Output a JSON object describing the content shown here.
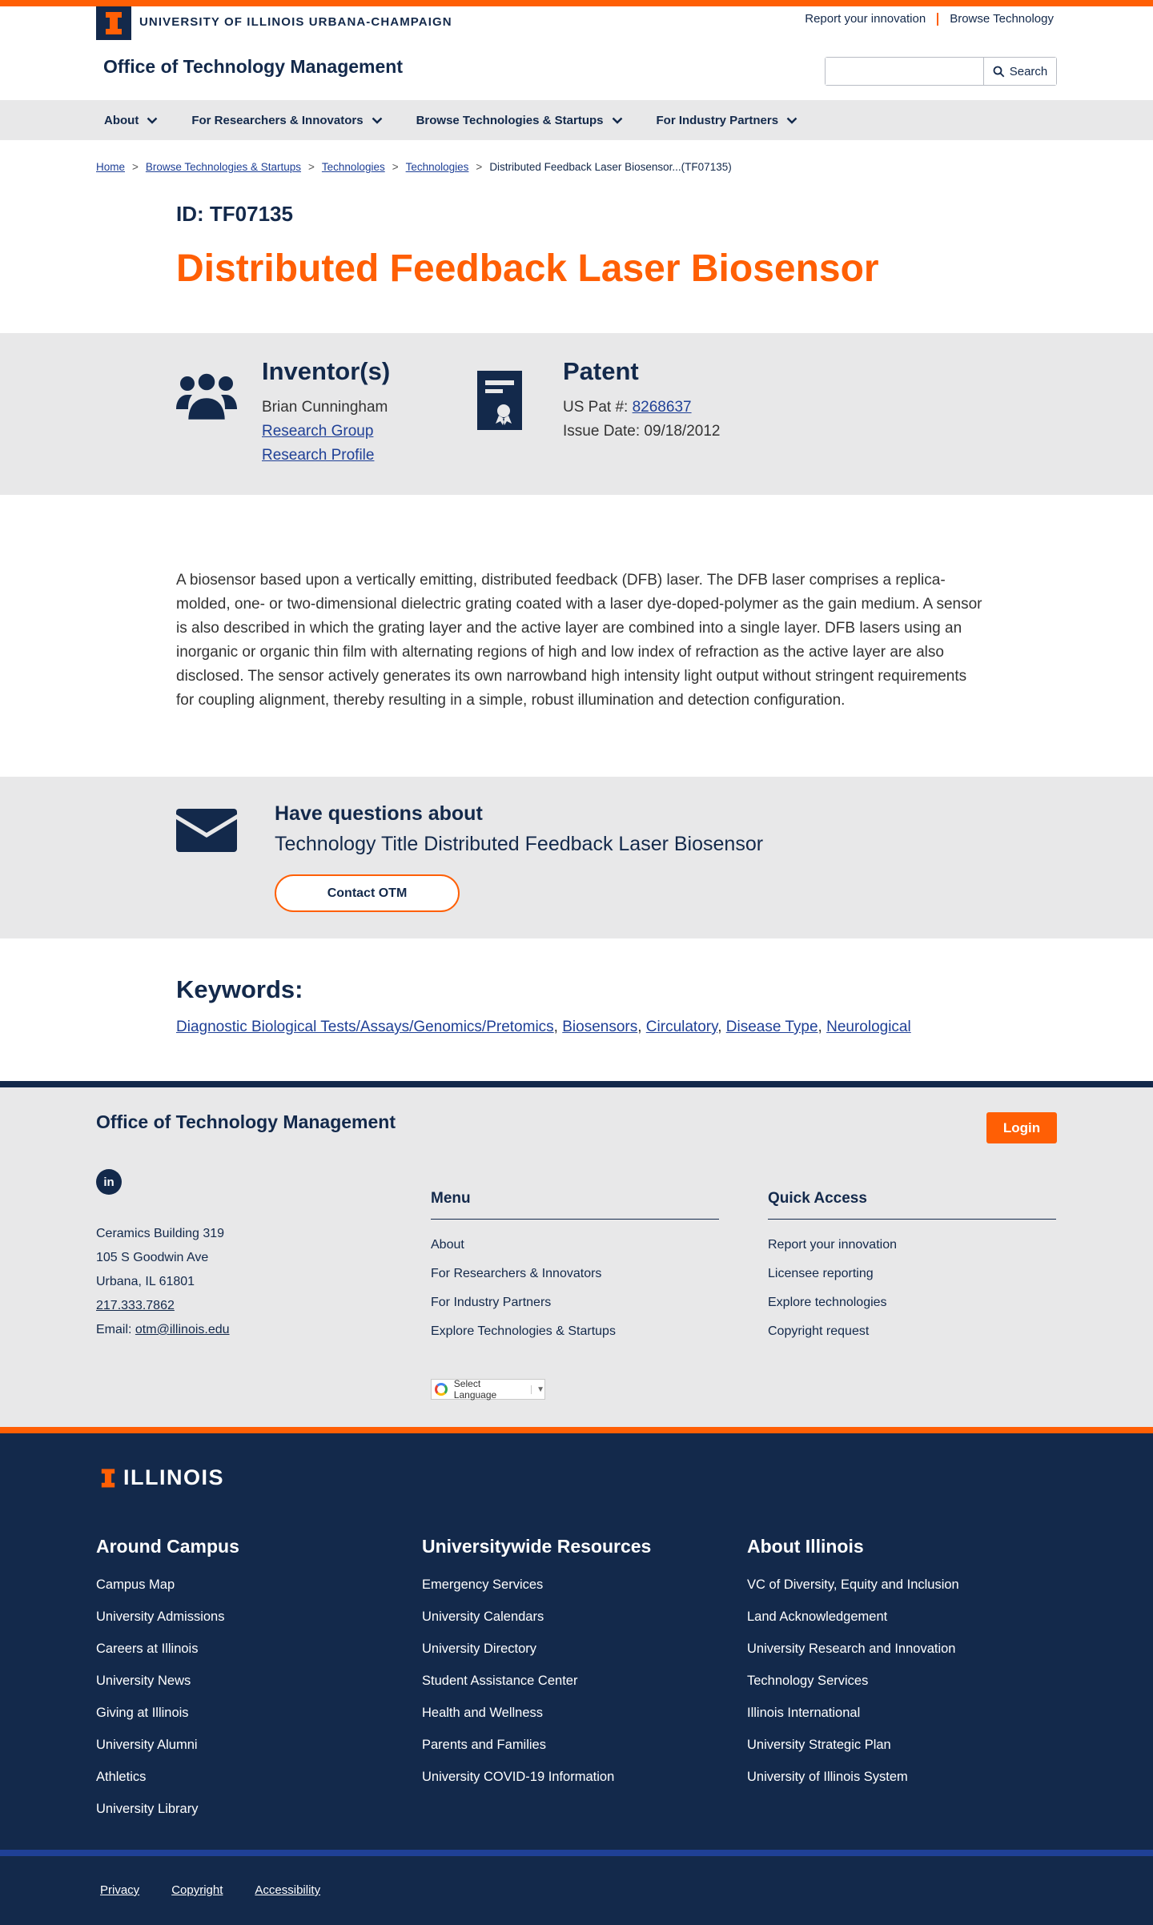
{
  "header": {
    "brand_text": "UNIVERSITY OF ILLINOIS URBANA-CHAMPAIGN",
    "util_links": [
      "Report your innovation",
      "Browse Technology"
    ],
    "office_title": "Office of Technology Management",
    "search_placeholder": "",
    "search_button": "Search"
  },
  "nav": {
    "items": [
      "About",
      "For Researchers & Innovators",
      "Browse Technologies & Startups",
      "For Industry Partners"
    ]
  },
  "breadcrumb": {
    "items": [
      "Home",
      "Browse Technologies & Startups",
      "Technologies",
      "Technologies"
    ],
    "current": "Distributed Feedback Laser Biosensor...(TF07135)"
  },
  "technology": {
    "id_label": "ID: TF07135",
    "title": "Distributed Feedback Laser Biosensor",
    "inventors_heading": "Inventor(s)",
    "inventor_name": "Brian Cunningham",
    "inventor_links": [
      "Research Group",
      "Research Profile"
    ],
    "patent_heading": "Patent",
    "patent_label": "US Pat #: ",
    "patent_number": "8268637",
    "issue_date": "Issue Date: 09/18/2012",
    "description": "A biosensor based upon a vertically emitting, distributed feedback (DFB) laser. The DFB laser comprises a replica-molded, one- or two-dimensional dielectric grating coated with a laser dye-doped-polymer as the gain medium. A sensor is also described in which the grating layer and the active layer are combined into a single layer. DFB lasers using an inorganic or organic thin film with alternating regions of high and low index of refraction as the active layer are also disclosed. The sensor actively generates its own narrowband high intensity light output without stringent requirements for coupling alignment, thereby resulting in a simple, robust illumination and detection configuration."
  },
  "questions": {
    "heading": "Have questions about",
    "subheading": "Technology Title Distributed Feedback Laser Biosensor",
    "button": "Contact OTM"
  },
  "keywords": {
    "heading": "Keywords:",
    "items": [
      "Diagnostic Biological Tests/Assays/Genomics/Pretomics",
      "Biosensors",
      "Circulatory",
      "Disease Type",
      "Neurological"
    ]
  },
  "footer": {
    "office_title": "Office of Technology Management",
    "login": "Login",
    "linkedin": "in",
    "address": [
      "Ceramics Building 319",
      "105 S Goodwin Ave",
      "Urbana, IL 61801"
    ],
    "phone": "217.333.7862",
    "email_label": "Email: ",
    "email": "otm@illinois.edu",
    "menu_heading": "Menu",
    "menu_items": [
      "About",
      "For Researchers & Innovators",
      "For Industry Partners",
      "Explore Technologies & Startups"
    ],
    "quick_heading": "Quick Access",
    "quick_items": [
      "Report your innovation",
      "Licensee reporting",
      "Explore technologies",
      "Copyright request"
    ],
    "language": "Select Language"
  },
  "campus_footer": {
    "logo_text": "ILLINOIS",
    "around_heading": "Around Campus",
    "around_items": [
      "Campus Map",
      "University Admissions",
      "Careers at Illinois",
      "University News",
      "Giving at Illinois",
      "University Alumni",
      "Athletics",
      "University Library"
    ],
    "resources_heading": "Universitywide Resources",
    "resources_items": [
      "Emergency Services",
      "University Calendars",
      "University Directory",
      "Student Assistance Center",
      "Health and Wellness",
      "Parents and Families",
      "University COVID-19 Information"
    ],
    "about_heading": "About Illinois",
    "about_items": [
      "VC of Diversity, Equity and Inclusion",
      "Land Acknowledgement",
      "University Research and Innovation",
      "Technology Services",
      "Illinois International",
      "University Strategic Plan",
      "University of Illinois System"
    ],
    "legal": [
      "Privacy",
      "Copyright",
      "Accessibility"
    ]
  },
  "colors": {
    "navy": "#13294b",
    "orange": "#ff5f05",
    "gray_band": "#e8e8e9",
    "link_blue": "#1f4096"
  }
}
